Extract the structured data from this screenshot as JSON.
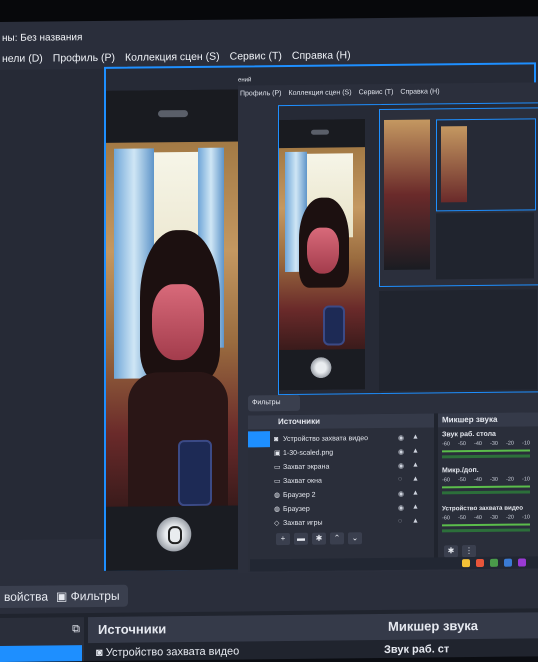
{
  "window": {
    "title": "ны: Без названия",
    "menu": [
      "нели (D)",
      "Профиль (P)",
      "Коллекция сцен (S)",
      "Сервис (T)",
      "Справка (H)"
    ]
  },
  "inner_window": {
    "title": "ений",
    "menu": [
      "Профиль (P)",
      "Коллекция сцен (S)",
      "Сервис (T)",
      "Справка (H)"
    ],
    "filters_label": "Фильтры",
    "sources": {
      "header": "Источники",
      "items": [
        {
          "label": "Устройство захвата видео",
          "icon": "camera-icon"
        },
        {
          "label": "1-30-scaled.png",
          "icon": "image-icon"
        },
        {
          "label": "Захват экрана",
          "icon": "monitor-icon"
        },
        {
          "label": "Захват окна",
          "icon": "window-icon"
        },
        {
          "label": "Браузер 2",
          "icon": "globe-icon"
        },
        {
          "label": "Браузер",
          "icon": "globe-icon"
        },
        {
          "label": "Захват игры",
          "icon": "gamepad-icon"
        }
      ]
    },
    "mixer": {
      "header": "Микшер звука",
      "channels": [
        {
          "label": "Звук раб. стола",
          "ticks": [
            "-60",
            "-50",
            "-40",
            "-30",
            "-20",
            "-10"
          ]
        },
        {
          "label": "Микр./доп.",
          "ticks": [
            "-60",
            "-50",
            "-40",
            "-30",
            "-20",
            "-10"
          ]
        },
        {
          "label": "Устройство захвата видео",
          "ticks": [
            "-60",
            "-50",
            "-40",
            "-30",
            "-20",
            "-10"
          ]
        }
      ]
    }
  },
  "bottom": {
    "properties_label": "войства",
    "filters_label": "Фильтры",
    "sources_header": "Источники",
    "mixer_header": "Микшер звука",
    "first_source": "Устройство захвата видео",
    "first_channel": "Звук раб. ст"
  },
  "colors": {
    "accent": "#1e8fff",
    "panel": "#2a2e3b",
    "dock": "#20242e",
    "meter": "#5bbd4b"
  }
}
